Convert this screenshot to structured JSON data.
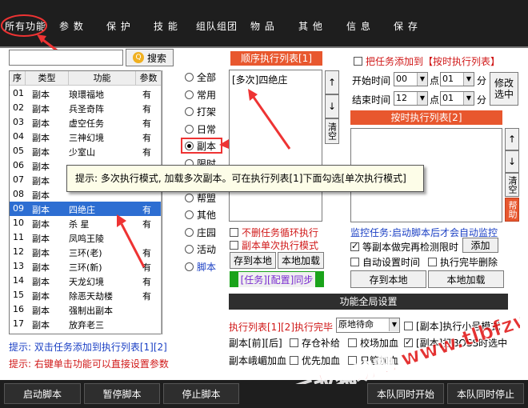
{
  "menu": {
    "items": [
      "所有功能",
      "参 数",
      "保 护",
      "技 能",
      "组队组团",
      "物 品",
      "其 他",
      "信 息",
      "保 存"
    ]
  },
  "search": {
    "value": "",
    "button_label": "搜索"
  },
  "table": {
    "headers": [
      "序",
      "类型",
      "功能",
      "参数"
    ],
    "rows": [
      [
        "01",
        "副本",
        "琅環福地",
        "有"
      ],
      [
        "02",
        "副本",
        "兵圣奇阵",
        "有"
      ],
      [
        "03",
        "副本",
        "虚空任务",
        "有"
      ],
      [
        "04",
        "副本",
        "三神幻境",
        "有"
      ],
      [
        "05",
        "副本",
        "少室山",
        "有"
      ],
      [
        "06",
        "副本",
        "",
        ""
      ],
      [
        "07",
        "副本",
        "",
        ""
      ],
      [
        "08",
        "副本",
        "",
        ""
      ],
      [
        "09",
        "副本",
        "四绝庄",
        "有"
      ],
      [
        "10",
        "副本",
        "杀  星",
        "有"
      ],
      [
        "11",
        "副本",
        "凤鸣王陵",
        ""
      ],
      [
        "12",
        "副本",
        "三环(老)",
        "有"
      ],
      [
        "13",
        "副本",
        "三环(新)",
        "有"
      ],
      [
        "14",
        "副本",
        "天龙幻境",
        "有"
      ],
      [
        "15",
        "副本",
        "除恶天劫楼",
        "有"
      ],
      [
        "16",
        "副本",
        "强制出副本",
        ""
      ],
      [
        "17",
        "副本",
        "放弃老三",
        ""
      ]
    ],
    "selected_index": 8
  },
  "hints": {
    "line1": "提示: 双击任务添加到执行列表[1][2]",
    "line2": "提示: 右键单击功能可以直接设置参数"
  },
  "categories": {
    "items": [
      "全部",
      "常用",
      "打架",
      "日常",
      "副本",
      "限时",
      "",
      "帮盟",
      "其他",
      "庄园",
      "活动",
      "脚本"
    ],
    "selected": "副本"
  },
  "sequence": {
    "header": "顺序执行列表[1]",
    "items": [
      "[多次]四绝庄"
    ],
    "up_label": "↑",
    "down_label": "↓",
    "clear_label": "清空",
    "chk_no_delete": "不删任务循环执行",
    "chk_single_mode": "副本单次执行模式",
    "save_local": "存到本地",
    "load_local": "本地加载",
    "sync_label": "[任务][配置]同步"
  },
  "timed": {
    "add_to_timed": "把任务添加到【按时执行列表】",
    "start_label": "开始时间",
    "end_label": "结束时间",
    "start_hour": "00",
    "start_min": "01",
    "end_hour": "12",
    "end_min": "01",
    "dian": "点",
    "fen": "分",
    "modify_label": "修改选中",
    "header": "按时执行列表[2]",
    "up_label": "↑",
    "down_label": "↓",
    "clear_label": "清空",
    "help_label": "帮助"
  },
  "monitor": {
    "title": "监控任务:启动脚本后才会自动监控",
    "chk_wait_limited": "等副本做完再检测限时",
    "add_label": "添加",
    "chk_auto_time": "自动设置时间",
    "chk_after_done": "执行完毕删除",
    "save_local": "存到本地",
    "load_local": "本地加载"
  },
  "global": {
    "header": "功能全局设置",
    "after_done_label": "执行列表[1][2]执行完毕",
    "after_done_value": "原地待命",
    "chk_small_mode": "[副本]执行小号模式",
    "front_back_label": "副本[前][后]",
    "chk_storage": "存仓补给",
    "chk_school": "校场加血",
    "chk_boss_team": "[副本]打BOSS时选中",
    "emei_label": "副本峨嵋加血",
    "chk_priority": "优先加血",
    "chk_only_manage": "只管加血"
  },
  "bottom": {
    "start": "启动脚本",
    "pause": "暂停脚本",
    "stop": "停止脚本",
    "team_start": "本队同时开始",
    "team_stop": "本队同时停止"
  },
  "tooltip": {
    "text": "提示: 多次执行模式, 加载多次副本。可在执行列表[1]下面勾选[单次执行模式]"
  },
  "watermark": {
    "text": "天龙辅助吧 www.tlbfzw.com"
  },
  "colors": {
    "accent_red": "#e8572e",
    "dark_bar": "#1e1e1e",
    "selected_row": "#2d6ed2",
    "hint_blue": "#1a3fc4",
    "hint_red": "#d01818",
    "watermark_red": "#e01010",
    "sync_purple": "#7a2bd0",
    "sync_green": "#1aa31a"
  }
}
